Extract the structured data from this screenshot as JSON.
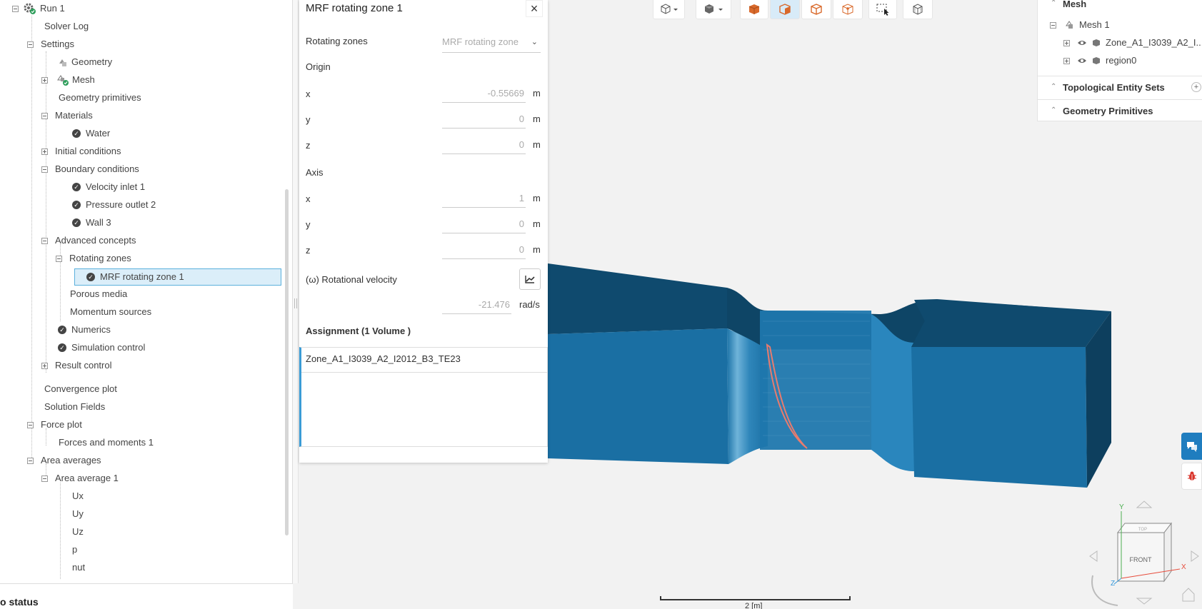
{
  "tree": {
    "run": "Run 1",
    "solver_log": "Solver Log",
    "settings": "Settings",
    "geometry": "Geometry",
    "mesh": "Mesh",
    "geometry_primitives": "Geometry primitives",
    "materials": "Materials",
    "water": "Water",
    "initial_conditions": "Initial conditions",
    "boundary_conditions": "Boundary conditions",
    "velocity_inlet": "Velocity inlet 1",
    "pressure_outlet": "Pressure outlet 2",
    "wall": "Wall 3",
    "advanced_concepts": "Advanced concepts",
    "rotating_zones": "Rotating zones",
    "mrf_zone": "MRF rotating zone 1",
    "porous_media": "Porous media",
    "momentum_sources": "Momentum sources",
    "numerics": "Numerics",
    "simulation_control": "Simulation control",
    "result_control": "Result control",
    "convergence_plot": "Convergence plot",
    "solution_fields": "Solution Fields",
    "force_plot": "Force plot",
    "forces_moments": "Forces and moments 1",
    "area_averages": "Area averages",
    "area_average_1": "Area average 1",
    "ux": "Ux",
    "uy": "Uy",
    "uz": "Uz",
    "p": "p",
    "nut": "nut"
  },
  "status": {
    "label": "o status"
  },
  "panel": {
    "title": "MRF rotating zone 1",
    "close": "×",
    "rotating_zones_label": "Rotating zones",
    "rotating_zones_value": "MRF rotating zone",
    "origin_label": "Origin",
    "axis_label": "Axis",
    "x_label": "x",
    "y_label": "y",
    "z_label": "z",
    "origin_x": "-0.55669",
    "origin_y": "0",
    "origin_z": "0",
    "axis_x": "1",
    "axis_y": "0",
    "axis_z": "0",
    "unit_m": "m",
    "rot_vel_label": "(ω) Rotational velocity",
    "rot_vel_value": "-21.476",
    "rot_vel_unit": "rad/s",
    "assignment_title": "Assignment (1 Volume )",
    "assignment_item": "Zone_A1_I3039_A2_I2012_B3_TE23"
  },
  "mesh_panel": {
    "title": "Mesh",
    "mesh1": "Mesh 1",
    "zone": "Zone_A1_I3039_A2_I...",
    "region": "region0",
    "topological": "Topological Entity Sets",
    "geometry_primitives": "Geometry Primitives"
  },
  "viewer": {
    "scale_label": "2 [m]",
    "cube_front": "FRONT",
    "cube_top": "TOP",
    "axis_x": "X",
    "axis_y": "Y",
    "axis_z": "Z"
  },
  "colors": {
    "geometry_main": "#1a6fa3",
    "geometry_dark": "#0f4a6e",
    "accent": "#3a9bd5",
    "impeller": "#e87b6e",
    "toolbar_orange": "#d9692b",
    "side_blue": "#1f7dbf"
  }
}
